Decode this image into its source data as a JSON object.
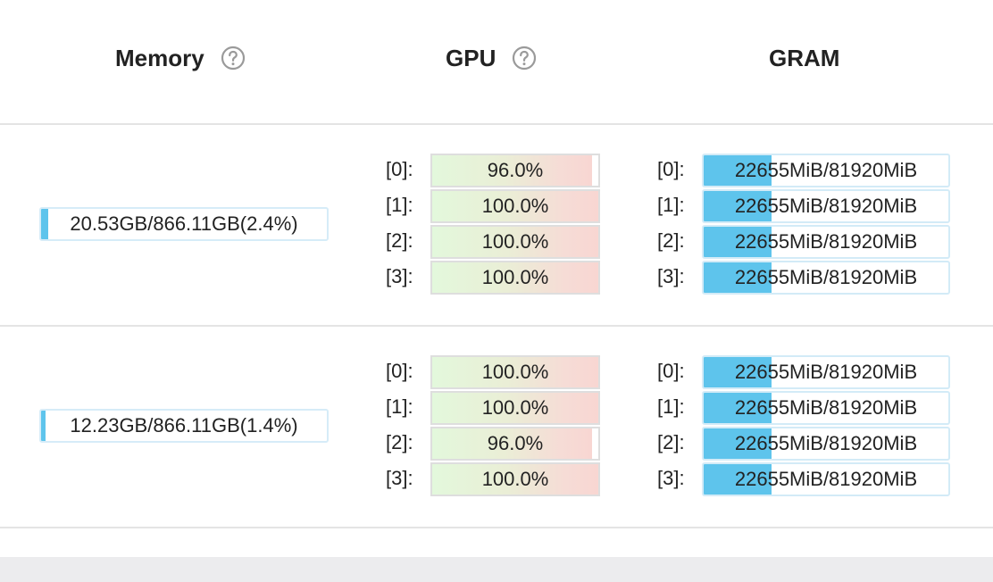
{
  "header": {
    "memory_label": "Memory",
    "gpu_label": "GPU",
    "gram_label": "GRAM",
    "memory_help_icon": "question-circle-icon",
    "gpu_help_icon": "question-circle-icon"
  },
  "colors": {
    "memory_fill": "#5ec4ec",
    "gram_fill": "#5ec4ec",
    "gpu_gradient_start": "#e3f8dc",
    "gpu_gradient_end": "#f8d6d2",
    "divider": "#e4e4e4"
  },
  "rows": [
    {
      "memory": {
        "text": "20.53GB/866.11GB(2.4%)",
        "percent": 2.4
      },
      "gpus": [
        {
          "index": "[0]:",
          "text": "96.0%",
          "percent": 96.0
        },
        {
          "index": "[1]:",
          "text": "100.0%",
          "percent": 100.0
        },
        {
          "index": "[2]:",
          "text": "100.0%",
          "percent": 100.0
        },
        {
          "index": "[3]:",
          "text": "100.0%",
          "percent": 100.0
        }
      ],
      "gram": [
        {
          "index": "[0]:",
          "text": "22655MiB/81920MiB",
          "used": 22655,
          "total": 81920
        },
        {
          "index": "[1]:",
          "text": "22655MiB/81920MiB",
          "used": 22655,
          "total": 81920
        },
        {
          "index": "[2]:",
          "text": "22655MiB/81920MiB",
          "used": 22655,
          "total": 81920
        },
        {
          "index": "[3]:",
          "text": "22655MiB/81920MiB",
          "used": 22655,
          "total": 81920
        }
      ]
    },
    {
      "memory": {
        "text": "12.23GB/866.11GB(1.4%)",
        "percent": 1.4
      },
      "gpus": [
        {
          "index": "[0]:",
          "text": "100.0%",
          "percent": 100.0
        },
        {
          "index": "[1]:",
          "text": "100.0%",
          "percent": 100.0
        },
        {
          "index": "[2]:",
          "text": "96.0%",
          "percent": 96.0
        },
        {
          "index": "[3]:",
          "text": "100.0%",
          "percent": 100.0
        }
      ],
      "gram": [
        {
          "index": "[0]:",
          "text": "22655MiB/81920MiB",
          "used": 22655,
          "total": 81920
        },
        {
          "index": "[1]:",
          "text": "22655MiB/81920MiB",
          "used": 22655,
          "total": 81920
        },
        {
          "index": "[2]:",
          "text": "22655MiB/81920MiB",
          "used": 22655,
          "total": 81920
        },
        {
          "index": "[3]:",
          "text": "22655MiB/81920MiB",
          "used": 22655,
          "total": 81920
        }
      ]
    }
  ]
}
